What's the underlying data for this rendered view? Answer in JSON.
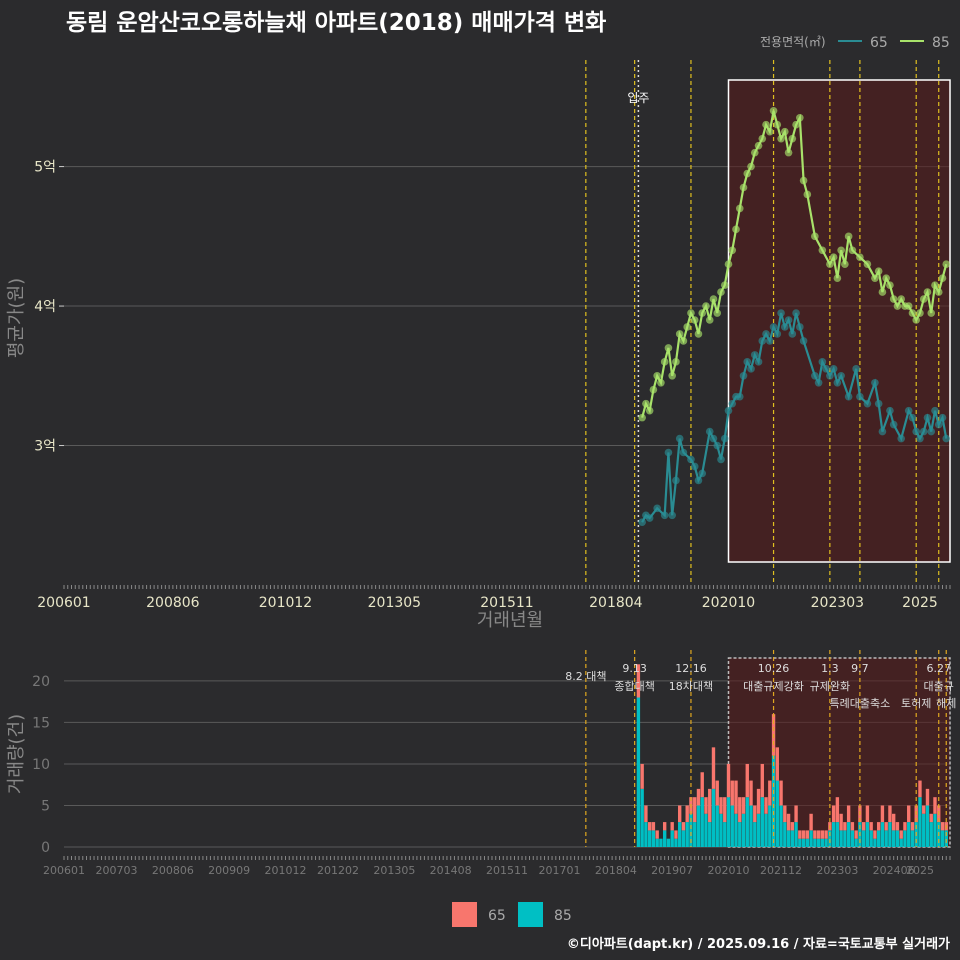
{
  "chart_data": [
    {
      "type": "line",
      "title": "동림 운암산코오롱하늘채 아파트(2018) 매매가격 변화",
      "xlabel": "거래년월",
      "ylabel": "평균가(원)",
      "legend_title": "전용면적(㎡)",
      "legend_position": "top-right",
      "x_range": [
        "2006-01",
        "2025-09"
      ],
      "ylim": [
        2.0,
        5.8
      ],
      "y_unit": "억",
      "yticks": [
        {
          "value": 3,
          "label": "3억"
        },
        {
          "value": 4,
          "label": "4억"
        },
        {
          "value": 5,
          "label": "5억"
        }
      ],
      "xticks": [
        "200601",
        "200806",
        "201012",
        "201305",
        "201511",
        "201804",
        "202010",
        "202303",
        "2025"
      ],
      "grid": true,
      "move_in_label": "입주",
      "move_in_date": "2018-10",
      "policy_dates": [
        "2017-08",
        "2018-09",
        "2019-12",
        "2021-10",
        "2023-01",
        "2023-09",
        "2024-12",
        "2025-06"
      ],
      "highlight_range": [
        "2020-10",
        "2025-09"
      ],
      "series": [
        {
          "name": "65",
          "color": "#2a8c93",
          "x": [
            "2018-11",
            "2018-12",
            "2019-01",
            "2019-03",
            "2019-05",
            "2019-06",
            "2019-07",
            "2019-08",
            "2019-09",
            "2019-10",
            "2019-12",
            "2020-01",
            "2020-02",
            "2020-03",
            "2020-05",
            "2020-06",
            "2020-07",
            "2020-08",
            "2020-09",
            "2020-10",
            "2020-11",
            "2020-12",
            "2021-01",
            "2021-02",
            "2021-03",
            "2021-04",
            "2021-05",
            "2021-06",
            "2021-07",
            "2021-08",
            "2021-09",
            "2021-10",
            "2021-11",
            "2021-12",
            "2022-01",
            "2022-02",
            "2022-03",
            "2022-04",
            "2022-05",
            "2022-06",
            "2022-09",
            "2022-10",
            "2022-11",
            "2022-12",
            "2023-01",
            "2023-02",
            "2023-03",
            "2023-04",
            "2023-06",
            "2023-08",
            "2023-09",
            "2023-11",
            "2024-01",
            "2024-02",
            "2024-03",
            "2024-05",
            "2024-06",
            "2024-08",
            "2024-10",
            "2024-11",
            "2024-12",
            "2025-01",
            "2025-02",
            "2025-03",
            "2025-04",
            "2025-05",
            "2025-06",
            "2025-07",
            "2025-08"
          ],
          "values": [
            2.45,
            2.5,
            2.48,
            2.55,
            2.5,
            2.95,
            2.5,
            2.75,
            3.05,
            2.95,
            2.9,
            2.85,
            2.75,
            2.8,
            3.1,
            3.05,
            3.0,
            2.9,
            3.05,
            3.25,
            3.3,
            3.35,
            3.35,
            3.5,
            3.6,
            3.55,
            3.65,
            3.6,
            3.75,
            3.8,
            3.75,
            3.85,
            3.8,
            3.95,
            3.85,
            3.9,
            3.8,
            3.95,
            3.85,
            3.75,
            3.5,
            3.45,
            3.6,
            3.55,
            3.5,
            3.55,
            3.45,
            3.5,
            3.35,
            3.55,
            3.35,
            3.3,
            3.45,
            3.3,
            3.1,
            3.25,
            3.15,
            3.05,
            3.25,
            3.2,
            3.1,
            3.05,
            3.1,
            3.2,
            3.1,
            3.25,
            3.15,
            3.2,
            3.05
          ]
        },
        {
          "name": "85",
          "color": "#a8e26a",
          "x": [
            "2018-11",
            "2018-12",
            "2019-01",
            "2019-02",
            "2019-03",
            "2019-04",
            "2019-05",
            "2019-06",
            "2019-07",
            "2019-08",
            "2019-09",
            "2019-10",
            "2019-11",
            "2019-12",
            "2020-01",
            "2020-02",
            "2020-03",
            "2020-04",
            "2020-05",
            "2020-06",
            "2020-07",
            "2020-08",
            "2020-09",
            "2020-10",
            "2020-11",
            "2020-12",
            "2021-01",
            "2021-02",
            "2021-03",
            "2021-04",
            "2021-05",
            "2021-06",
            "2021-07",
            "2021-08",
            "2021-09",
            "2021-10",
            "2021-11",
            "2021-12",
            "2022-01",
            "2022-02",
            "2022-03",
            "2022-04",
            "2022-05",
            "2022-06",
            "2022-07",
            "2022-09",
            "2022-11",
            "2023-01",
            "2023-02",
            "2023-03",
            "2023-04",
            "2023-05",
            "2023-06",
            "2023-07",
            "2023-09",
            "2023-11",
            "2024-01",
            "2024-02",
            "2024-03",
            "2024-04",
            "2024-05",
            "2024-06",
            "2024-07",
            "2024-08",
            "2024-09",
            "2024-10",
            "2024-11",
            "2024-12",
            "2025-01",
            "2025-02",
            "2025-03",
            "2025-04",
            "2025-05",
            "2025-06",
            "2025-07",
            "2025-08"
          ],
          "values": [
            3.2,
            3.3,
            3.25,
            3.4,
            3.5,
            3.45,
            3.6,
            3.7,
            3.5,
            3.6,
            3.8,
            3.75,
            3.85,
            3.95,
            3.9,
            3.8,
            3.95,
            4.0,
            3.9,
            4.05,
            3.95,
            4.1,
            4.15,
            4.3,
            4.4,
            4.55,
            4.7,
            4.85,
            4.95,
            5.0,
            5.1,
            5.15,
            5.2,
            5.3,
            5.25,
            5.4,
            5.3,
            5.2,
            5.25,
            5.1,
            5.2,
            5.3,
            5.35,
            4.9,
            4.8,
            4.5,
            4.4,
            4.3,
            4.35,
            4.2,
            4.4,
            4.3,
            4.5,
            4.4,
            4.35,
            4.3,
            4.2,
            4.25,
            4.1,
            4.2,
            4.15,
            4.05,
            4.0,
            4.05,
            4.0,
            4.0,
            3.95,
            3.9,
            3.95,
            4.05,
            4.1,
            3.95,
            4.15,
            4.1,
            4.2,
            4.3
          ]
        }
      ]
    },
    {
      "type": "bar",
      "ylabel": "거래량(건)",
      "stacked": true,
      "ylim": [
        0,
        23
      ],
      "yticks": [
        0,
        5,
        10,
        15,
        20
      ],
      "xticks": [
        "200601",
        "200703",
        "200806",
        "200909",
        "201012",
        "201202",
        "201305",
        "201408",
        "201511",
        "201701",
        "201804",
        "201907",
        "202010",
        "202112",
        "202303",
        "202406",
        "2025"
      ],
      "grid": true,
      "highlight_range": [
        "2020-10",
        "2025-09"
      ],
      "policies": [
        {
          "date": "2017-08",
          "label1": "8.2 대책",
          "label2": ""
        },
        {
          "date": "2018-09",
          "label1": "9.13",
          "label2": "종합대책"
        },
        {
          "date": "2019-12",
          "label1": "12.16",
          "label2": "18차대책"
        },
        {
          "date": "2021-10",
          "label1": "10.26",
          "label2": "대출규제강화"
        },
        {
          "date": "2023-01",
          "label1": "1.3",
          "label2": "규제완화"
        },
        {
          "date": "2023-09",
          "label1": "9.7",
          "label2": "특례대출축소"
        },
        {
          "date": "2024-12",
          "label1": "",
          "label2": "토허제"
        },
        {
          "date": "2025-06",
          "label1": "6.27",
          "label2": "대출규"
        },
        {
          "date": "2025-08",
          "label1": "",
          "label2": "해제"
        }
      ],
      "legend": [
        {
          "name": "65",
          "color": "#f8766d"
        },
        {
          "name": "85",
          "color": "#00bfc4"
        }
      ],
      "series": [
        {
          "name": "65",
          "color": "#f8766d",
          "x": [
            "2018-10",
            "2018-11",
            "2018-12",
            "2019-01",
            "2019-02",
            "2019-03",
            "2019-04",
            "2019-05",
            "2019-06",
            "2019-07",
            "2019-08",
            "2019-09",
            "2019-10",
            "2019-11",
            "2019-12",
            "2020-01",
            "2020-02",
            "2020-03",
            "2020-04",
            "2020-05",
            "2020-06",
            "2020-07",
            "2020-08",
            "2020-09",
            "2020-10",
            "2020-11",
            "2020-12",
            "2021-01",
            "2021-02",
            "2021-03",
            "2021-04",
            "2021-05",
            "2021-06",
            "2021-07",
            "2021-08",
            "2021-09",
            "2021-10",
            "2021-11",
            "2021-12",
            "2022-01",
            "2022-02",
            "2022-03",
            "2022-04",
            "2022-05",
            "2022-06",
            "2022-07",
            "2022-08",
            "2022-09",
            "2022-10",
            "2022-11",
            "2022-12",
            "2023-01",
            "2023-02",
            "2023-03",
            "2023-04",
            "2023-05",
            "2023-06",
            "2023-07",
            "2023-08",
            "2023-09",
            "2023-10",
            "2023-11",
            "2023-12",
            "2024-01",
            "2024-02",
            "2024-03",
            "2024-04",
            "2024-05",
            "2024-06",
            "2024-07",
            "2024-08",
            "2024-09",
            "2024-10",
            "2024-11",
            "2024-12",
            "2025-01",
            "2025-02",
            "2025-03",
            "2025-04",
            "2025-05",
            "2025-06",
            "2025-07",
            "2025-08"
          ],
          "values": [
            4,
            3,
            2,
            1,
            1,
            1,
            0,
            1,
            0,
            1,
            1,
            2,
            1,
            2,
            2,
            3,
            2,
            3,
            2,
            4,
            5,
            3,
            2,
            3,
            4,
            3,
            4,
            3,
            2,
            4,
            3,
            2,
            3,
            4,
            2,
            3,
            5,
            4,
            3,
            2,
            2,
            1,
            2,
            1,
            1,
            1,
            2,
            1,
            1,
            1,
            1,
            1,
            2,
            3,
            2,
            1,
            2,
            1,
            1,
            2,
            1,
            2,
            1,
            1,
            1,
            2,
            1,
            2,
            2,
            1,
            1,
            1,
            2,
            1,
            2,
            2,
            1,
            2,
            1,
            2,
            2,
            1,
            1
          ]
        },
        {
          "name": "85",
          "color": "#00bfc4",
          "x": [
            "2018-10",
            "2018-11",
            "2018-12",
            "2019-01",
            "2019-02",
            "2019-03",
            "2019-04",
            "2019-05",
            "2019-06",
            "2019-07",
            "2019-08",
            "2019-09",
            "2019-10",
            "2019-11",
            "2019-12",
            "2020-01",
            "2020-02",
            "2020-03",
            "2020-04",
            "2020-05",
            "2020-06",
            "2020-07",
            "2020-08",
            "2020-09",
            "2020-10",
            "2020-11",
            "2020-12",
            "2021-01",
            "2021-02",
            "2021-03",
            "2021-04",
            "2021-05",
            "2021-06",
            "2021-07",
            "2021-08",
            "2021-09",
            "2021-10",
            "2021-11",
            "2021-12",
            "2022-01",
            "2022-02",
            "2022-03",
            "2022-04",
            "2022-05",
            "2022-06",
            "2022-07",
            "2022-08",
            "2022-09",
            "2022-10",
            "2022-11",
            "2022-12",
            "2023-01",
            "2023-02",
            "2023-03",
            "2023-04",
            "2023-05",
            "2023-06",
            "2023-07",
            "2023-08",
            "2023-09",
            "2023-10",
            "2023-11",
            "2023-12",
            "2024-01",
            "2024-02",
            "2024-03",
            "2024-04",
            "2024-05",
            "2024-06",
            "2024-07",
            "2024-08",
            "2024-09",
            "2024-10",
            "2024-11",
            "2024-12",
            "2025-01",
            "2025-02",
            "2025-03",
            "2025-04",
            "2025-05",
            "2025-06",
            "2025-07",
            "2025-08"
          ],
          "values": [
            18,
            7,
            3,
            2,
            2,
            1,
            1,
            2,
            1,
            2,
            1,
            3,
            2,
            3,
            4,
            3,
            5,
            6,
            4,
            3,
            7,
            5,
            4,
            3,
            6,
            5,
            4,
            3,
            4,
            6,
            5,
            3,
            4,
            6,
            4,
            5,
            11,
            8,
            5,
            3,
            2,
            2,
            3,
            1,
            1,
            1,
            2,
            1,
            1,
            1,
            1,
            2,
            3,
            3,
            2,
            2,
            3,
            2,
            1,
            3,
            2,
            3,
            2,
            1,
            2,
            3,
            2,
            3,
            2,
            2,
            1,
            2,
            3,
            2,
            3,
            6,
            4,
            5,
            3,
            4,
            3,
            2,
            2
          ]
        }
      ]
    }
  ],
  "footer": "©디아파트(dapt.kr) / 2025.09.16 / 자료=국토교통부 실거래가"
}
